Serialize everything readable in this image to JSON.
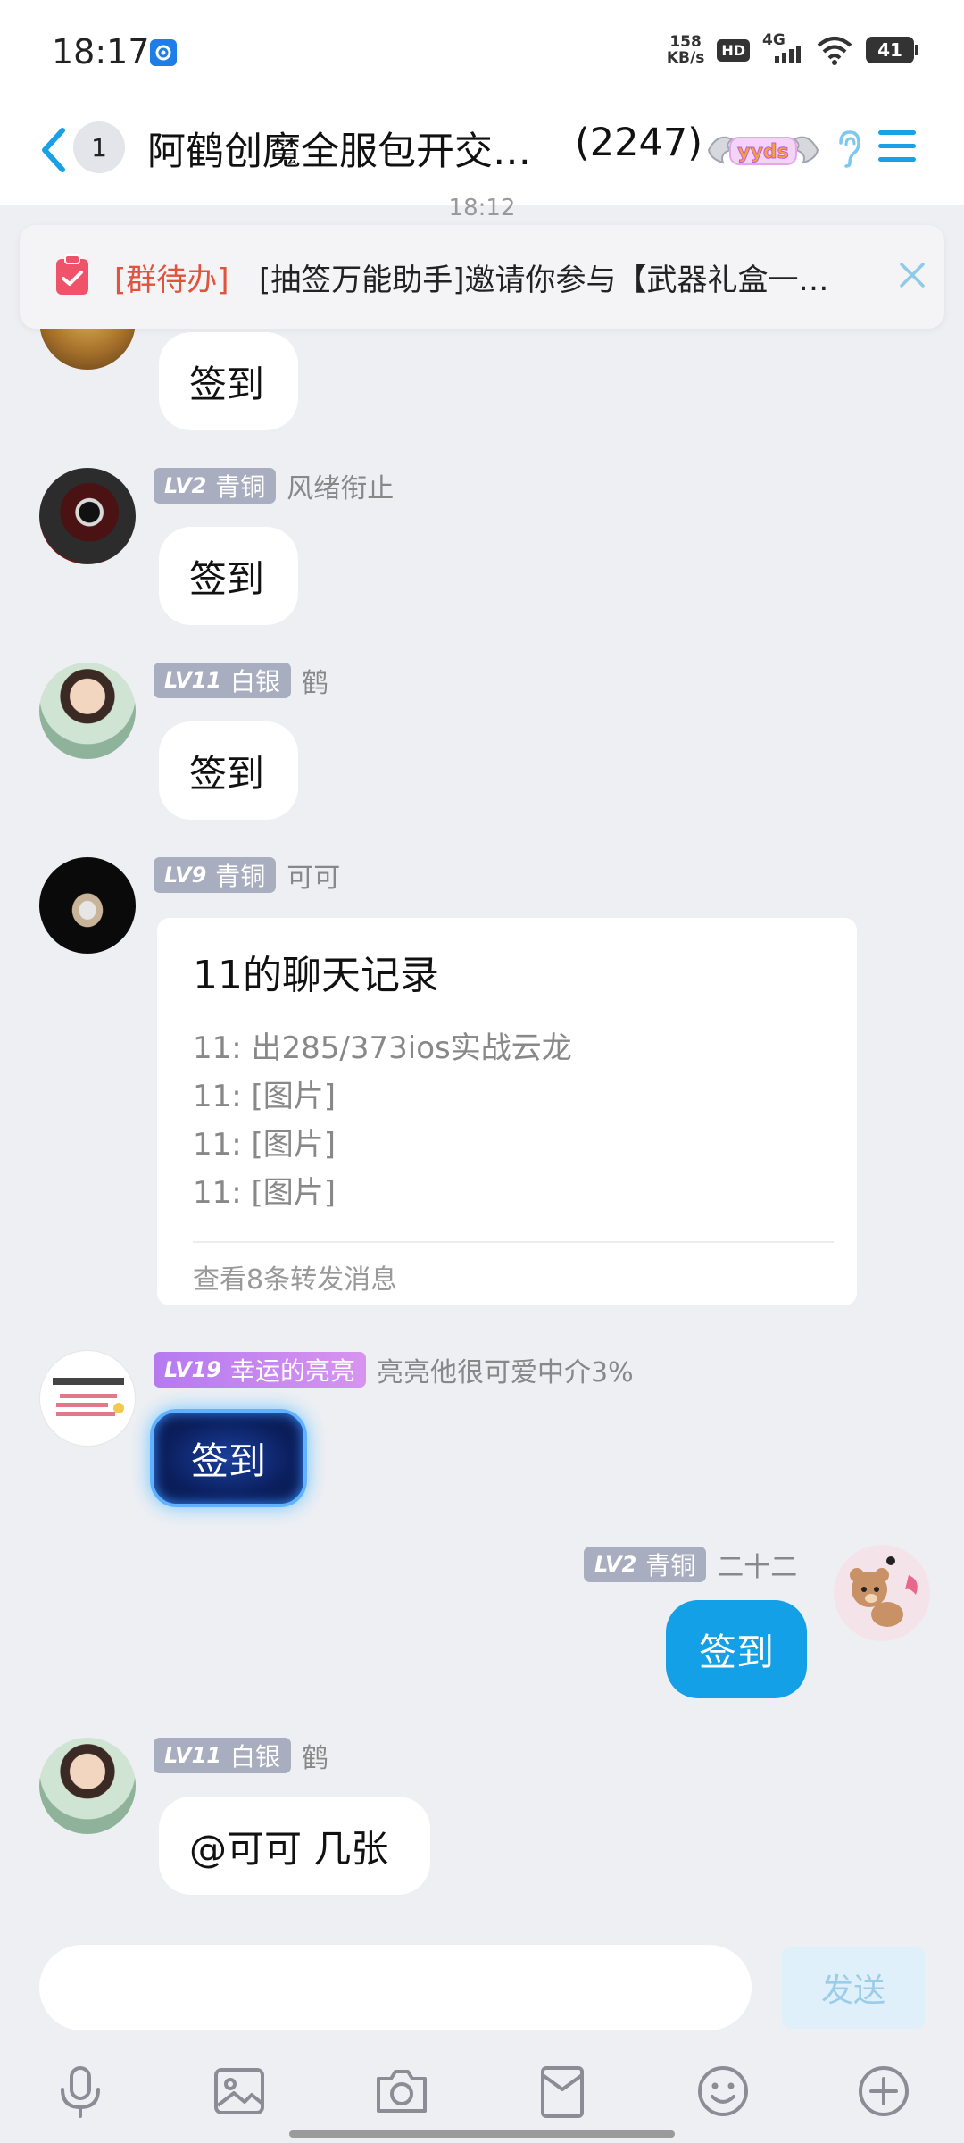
{
  "status_bar": {
    "time": "18:17",
    "net_speed_value": "158",
    "net_speed_unit": "KB/s",
    "hd": "HD",
    "network": "4G",
    "battery": "41"
  },
  "header": {
    "unread_count": "1",
    "title": "阿鹤创魔全服包开交…",
    "member_count": "(2247)",
    "badge_text": "yyds"
  },
  "notice": {
    "time": "18:12",
    "tag": "[群待办]",
    "text": "[抽签万能助手]邀请你参与【武器礼盒一…"
  },
  "messages": [
    {
      "text": "签到"
    },
    {
      "level": "LV2",
      "title": "青铜",
      "nick": "风绪衔止",
      "text": "签到"
    },
    {
      "level": "LV11",
      "title": "白银",
      "nick": "鹤",
      "text": "签到"
    },
    {
      "level": "LV9",
      "title": "青铜",
      "nick": "可可",
      "forward": {
        "title": "11的聊天记录",
        "lines": [
          "11: 出285/373ios实战云龙",
          "11: [图片]",
          "11: [图片]",
          "11: [图片]"
        ],
        "footer": "查看8条转发消息"
      }
    },
    {
      "level": "LV19",
      "title": "幸运的亮亮",
      "nick": "亮亮他很可爱中介3%",
      "text": "签到"
    },
    {
      "level": "LV2",
      "title": "青铜",
      "nick": "二十二",
      "text": "签到"
    },
    {
      "level": "LV11",
      "title": "白银",
      "nick": "鹤",
      "text": "@可可 几张"
    }
  ],
  "input": {
    "placeholder": "",
    "send_label": "发送"
  },
  "colors": {
    "accent": "#13a0e6",
    "badge_gray": "#a8adbf",
    "badge_purple": "#c688f0",
    "notice_tag": "#e0533d"
  }
}
